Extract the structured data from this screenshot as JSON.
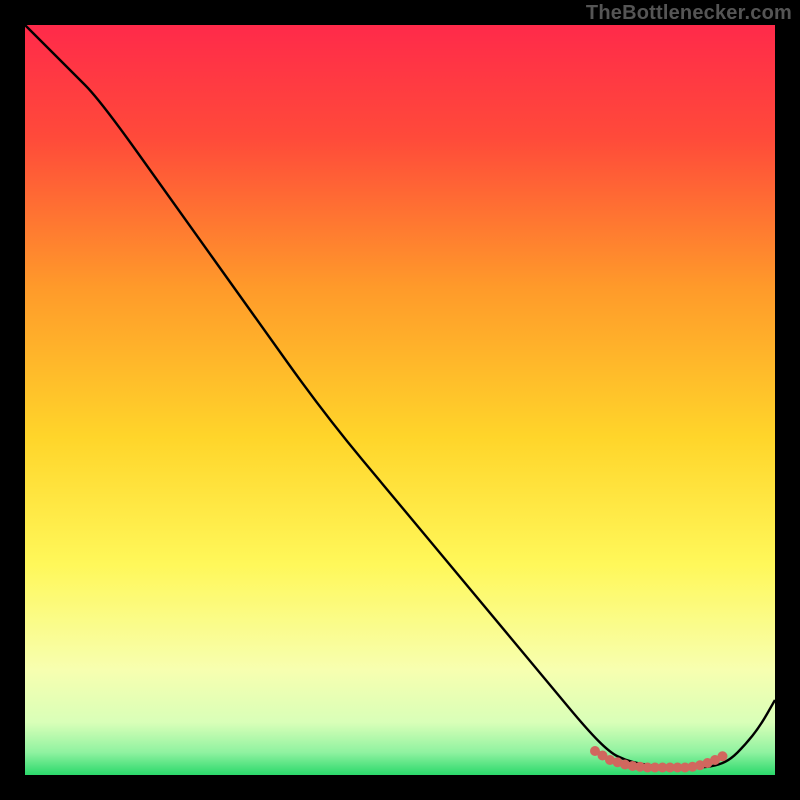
{
  "watermark": "TheBottlenecker.com",
  "colors": {
    "frame": "#000000",
    "curve": "#000000",
    "dots": "#d1675e",
    "gradient_top": "#ff2a4a",
    "gradient_mid_upper": "#ff7a2a",
    "gradient_mid": "#ffd52a",
    "gradient_mid_lower": "#fff85a",
    "gradient_low": "#f7ffb0",
    "gradient_bottom": "#2bd96b"
  },
  "chart_data": {
    "type": "line",
    "title": "",
    "xlabel": "",
    "ylabel": "",
    "xlim": [
      0,
      100
    ],
    "ylim": [
      0,
      100
    ],
    "x": [
      0,
      6,
      10,
      20,
      30,
      40,
      50,
      60,
      70,
      75,
      78,
      80,
      82,
      84,
      86,
      88,
      90,
      92,
      94,
      96,
      98,
      100
    ],
    "values": [
      100,
      94,
      90,
      76,
      62,
      48,
      36,
      24,
      12,
      6,
      3,
      2,
      1.5,
      1.2,
      1,
      1,
      1,
      1.2,
      2,
      4,
      6.5,
      10
    ],
    "dots": {
      "x": [
        76,
        77,
        78,
        79,
        80,
        81,
        82,
        83,
        84,
        85,
        86,
        87,
        88,
        89,
        90,
        91,
        92,
        93
      ],
      "y": [
        3.2,
        2.6,
        2.0,
        1.7,
        1.4,
        1.2,
        1.1,
        1.0,
        1.0,
        1.0,
        1.0,
        1.0,
        1.0,
        1.1,
        1.3,
        1.6,
        2.0,
        2.5
      ]
    },
    "gradient_stops": [
      {
        "offset": 0.0,
        "color": "#ff2a4a"
      },
      {
        "offset": 0.15,
        "color": "#ff4a3a"
      },
      {
        "offset": 0.35,
        "color": "#ff9a2a"
      },
      {
        "offset": 0.55,
        "color": "#ffd52a"
      },
      {
        "offset": 0.72,
        "color": "#fff85a"
      },
      {
        "offset": 0.86,
        "color": "#f7ffb0"
      },
      {
        "offset": 0.93,
        "color": "#d9ffb8"
      },
      {
        "offset": 0.97,
        "color": "#8ff2a0"
      },
      {
        "offset": 1.0,
        "color": "#2bd96b"
      }
    ]
  }
}
